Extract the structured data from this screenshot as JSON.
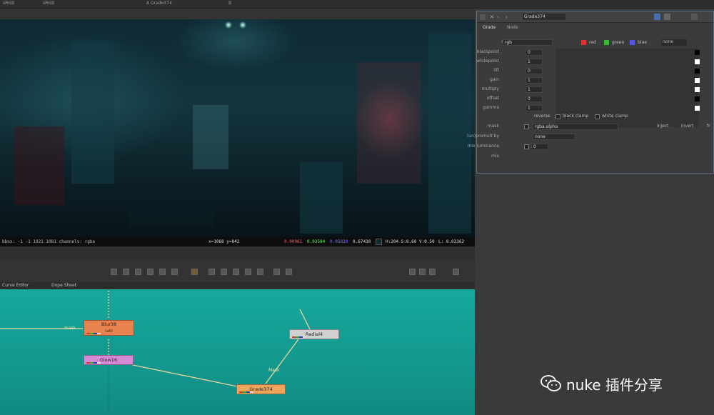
{
  "topbar": {
    "tabs": [
      "sRGB",
      "sRGB",
      "A  Grade374",
      "B"
    ]
  },
  "viewer": {
    "info_left": "bbox: -1 -1 1921 1081 channels: rgba",
    "coords": "x=1068 y=842",
    "r_val": "0.00961",
    "g_val": "0.03584",
    "b_val": "0.05020",
    "a_val": "0.67430",
    "hsv": "H:204 S:0.60 V:0.50",
    "luma": "L: 0.03362"
  },
  "panel_tabs": [
    "Curve Editor",
    "Dope Sheet"
  ],
  "nodegraph": {
    "nodes": [
      {
        "name": "Blur38",
        "sub": "(all)",
        "color": "#e8834f"
      },
      {
        "name": "Glow16",
        "color": "#d58ad6"
      },
      {
        "name": "Radial4",
        "color": "#d0d0d0"
      },
      {
        "name": "Grade374",
        "color": "#f2a55a"
      }
    ],
    "edge_labels": [
      "mask",
      "Mask"
    ]
  },
  "properties": {
    "title": "Grade374",
    "tabs": [
      "Grade",
      "Node"
    ],
    "channels_label": "channels",
    "channels_value": "rgb",
    "channel_toggles": [
      "red",
      "green",
      "blue"
    ],
    "channel_extra": "none",
    "rows": [
      {
        "label": "blackpoint",
        "value": "0"
      },
      {
        "label": "whitepoint",
        "value": "1"
      },
      {
        "label": "lift",
        "value": "0"
      },
      {
        "label": "gain",
        "value": "1"
      },
      {
        "label": "multiply",
        "value": "1"
      },
      {
        "label": "offset",
        "value": "0"
      },
      {
        "label": "gamma",
        "value": "1"
      }
    ],
    "clamp_labels": [
      "reverse",
      "black clamp",
      "white clamp"
    ],
    "mask_label": "mask",
    "mask_value": "rgba.alpha",
    "mask_options": [
      "inject",
      "invert",
      "fr"
    ],
    "unpremult_label": "(un)premult by",
    "unpremult_value": "none",
    "mix_lum_label": "mix luminance",
    "mix_lum_value": "0",
    "mix_label": "mix"
  },
  "colors": {
    "viewer_bg": "#0f2a33",
    "graph_bg": "#17a89c",
    "panel_border": "#5a6d8a"
  },
  "watermark": {
    "text": "nuke 插件分享",
    "icon": "wechat-icon"
  }
}
